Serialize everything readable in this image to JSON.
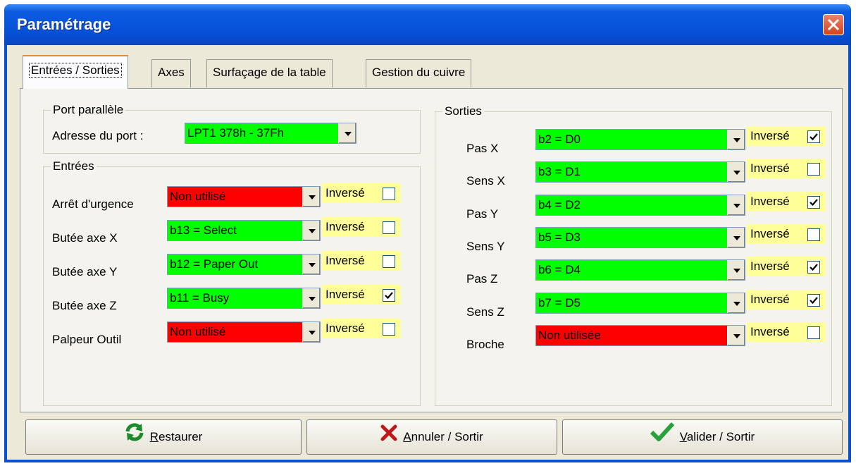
{
  "window": {
    "title": "Paramétrage"
  },
  "tabs": [
    {
      "label": "Entrées / Sorties",
      "active": true
    },
    {
      "label": "Axes"
    },
    {
      "label": "Surfaçage de la table"
    },
    {
      "label": "Gestion du cuivre"
    }
  ],
  "port": {
    "group_label": "Port parallèle",
    "address_label": "Adresse du port :",
    "address_value": "LPT1  378h - 37Fh"
  },
  "inputs": {
    "group_label": "Entrées",
    "rows": [
      {
        "label": "Arrêt d'urgence",
        "value": "Non utilisé",
        "color": "#ff0000",
        "inverse_label": "Inversé",
        "checked": false
      },
      {
        "label": "Butée axe X",
        "value": "b13 = Select",
        "color": "#00ff00",
        "inverse_label": "Inversé",
        "checked": false
      },
      {
        "label": "Butée axe Y",
        "value": "b12 = Paper Out",
        "color": "#00ff00",
        "inverse_label": "Inversé",
        "checked": false
      },
      {
        "label": "Butée axe Z",
        "value": "b11 = Busy",
        "color": "#00ff00",
        "inverse_label": "Inversé",
        "checked": true
      },
      {
        "label": "Palpeur Outil",
        "value": "Non utilisé",
        "color": "#ff0000",
        "inverse_label": "Inversé",
        "checked": false
      }
    ]
  },
  "outputs": {
    "group_label": "Sorties",
    "rows": [
      {
        "label": "Pas X",
        "value": "b2 = D0",
        "color": "#00ff00",
        "inverse_label": "Inversé",
        "checked": true
      },
      {
        "label": "Sens X",
        "value": "b3 = D1",
        "color": "#00ff00",
        "inverse_label": "Inversé",
        "checked": false
      },
      {
        "label": "Pas Y",
        "value": "b4 = D2",
        "color": "#00ff00",
        "inverse_label": "Inversé",
        "checked": true
      },
      {
        "label": "Sens Y",
        "value": "b5 = D3",
        "color": "#00ff00",
        "inverse_label": "Inversé",
        "checked": false
      },
      {
        "label": "Pas Z",
        "value": "b6 = D4",
        "color": "#00ff00",
        "inverse_label": "Inversé",
        "checked": true
      },
      {
        "label": "Sens Z",
        "value": "b7 = D5",
        "color": "#00ff00",
        "inverse_label": "Inversé",
        "checked": true
      },
      {
        "label": "Broche",
        "value": "Non utilisée",
        "color": "#ff0000",
        "inverse_label": "Inversé",
        "checked": false
      }
    ]
  },
  "buttons": {
    "restore": {
      "mnemonic": "R",
      "rest": "estaurer",
      "icon": "refresh-icon"
    },
    "cancel": {
      "mnemonic": "A",
      "rest": "nnuler / Sortir",
      "icon": "close-icon"
    },
    "validate": {
      "mnemonic": "V",
      "rest": "alider / Sortir",
      "icon": "checkmark-icon"
    }
  }
}
